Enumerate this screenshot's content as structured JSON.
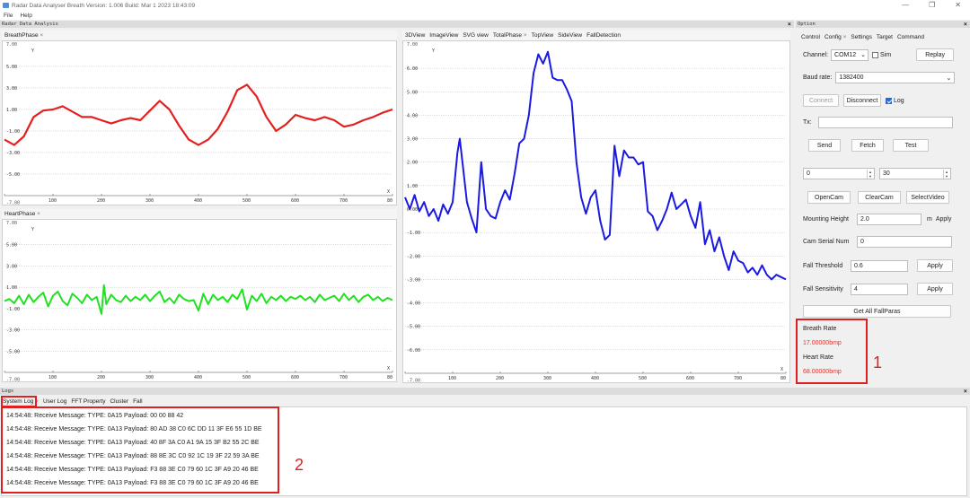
{
  "window": {
    "title": "Radar Data Analyser Breath Version: 1.006 Build: Mar  1 2023 18:43:09",
    "minimize": "—",
    "restore": "❐",
    "close": "✕"
  },
  "menu": [
    "File",
    "Help"
  ],
  "analysis": {
    "header": "Radar Data Analysis",
    "close": "×"
  },
  "breath_plot": {
    "tab": "BreathPhase",
    "chart_data": {
      "type": "line",
      "xlabel": "X",
      "ylabel": "Y",
      "xlim": [
        0,
        800
      ],
      "ylim": [
        -7,
        7
      ],
      "x_ticks": [
        0,
        100,
        200,
        300,
        400,
        500,
        600,
        700,
        800
      ],
      "x_tick_labels": [
        "0",
        "100",
        "200",
        "300",
        "400",
        "500",
        "600",
        "700",
        "80"
      ],
      "y_ticks": [
        5,
        3,
        1,
        -1,
        -3,
        -5
      ],
      "y_tick_labels": [
        "5.00",
        "3.00",
        "1.00",
        "-1.00",
        "-3.00",
        "-5.00"
      ],
      "y_top_label": "7.00",
      "y_bottom_label": "-7.00",
      "series": [
        {
          "color": "#e32020",
          "x": [
            0,
            20,
            40,
            60,
            80,
            100,
            120,
            140,
            160,
            180,
            200,
            220,
            240,
            260,
            280,
            300,
            320,
            340,
            360,
            380,
            400,
            420,
            440,
            460,
            480,
            500,
            520,
            540,
            560,
            580,
            600,
            620,
            640,
            660,
            680,
            700,
            720,
            740,
            760,
            780,
            800
          ],
          "y": [
            -1.8,
            -2.3,
            -1.5,
            0.3,
            0.9,
            1.0,
            1.3,
            0.8,
            0.3,
            0.3,
            0.0,
            -0.3,
            0.0,
            0.2,
            0.0,
            0.9,
            1.8,
            1.0,
            -0.5,
            -1.8,
            -2.3,
            -1.8,
            -0.8,
            0.8,
            2.8,
            3.3,
            2.2,
            0.3,
            -1.0,
            -0.4,
            0.5,
            0.2,
            0.0,
            0.3,
            0.0,
            -0.6,
            -0.4,
            0.0,
            0.3,
            0.7,
            1.0
          ]
        }
      ]
    }
  },
  "heart_plot": {
    "tab": "HeartPhase",
    "chart_data": {
      "type": "line",
      "xlabel": "X",
      "ylabel": "Y",
      "xlim": [
        0,
        800
      ],
      "ylim": [
        -7,
        7
      ],
      "x_ticks": [
        0,
        100,
        200,
        300,
        400,
        500,
        600,
        700,
        800
      ],
      "x_tick_labels": [
        "0",
        "100",
        "200",
        "300",
        "400",
        "500",
        "600",
        "700",
        "80"
      ],
      "y_ticks": [
        5,
        3,
        1,
        -1,
        -3,
        -5
      ],
      "y_tick_labels": [
        "5.00",
        "3.00",
        "1.00",
        "-1.00",
        "-3.00",
        "-5.00"
      ],
      "y_top_label": "7.00",
      "y_bottom_label": "-7.00",
      "series": [
        {
          "color": "#22e022",
          "x": [
            0,
            10,
            20,
            30,
            40,
            50,
            60,
            70,
            80,
            90,
            100,
            110,
            120,
            130,
            140,
            150,
            160,
            170,
            180,
            190,
            200,
            205,
            210,
            220,
            230,
            240,
            250,
            260,
            270,
            280,
            290,
            300,
            310,
            320,
            330,
            340,
            350,
            360,
            370,
            380,
            390,
            400,
            410,
            420,
            430,
            440,
            450,
            460,
            470,
            480,
            490,
            500,
            510,
            520,
            530,
            540,
            550,
            560,
            570,
            580,
            590,
            600,
            610,
            620,
            630,
            640,
            650,
            660,
            670,
            680,
            690,
            700,
            710,
            720,
            730,
            740,
            750,
            760,
            770,
            780,
            790,
            800
          ],
          "y": [
            -0.3,
            -0.1,
            -0.5,
            0.2,
            -0.6,
            0.3,
            -0.4,
            0.1,
            0.5,
            -0.8,
            0.2,
            0.6,
            -0.3,
            -0.7,
            0.4,
            0.0,
            -0.5,
            0.3,
            -0.2,
            0.1,
            -1.5,
            1.2,
            -0.6,
            0.3,
            -0.2,
            -0.4,
            0.2,
            -0.3,
            0.1,
            -0.2,
            0.3,
            -0.3,
            0.2,
            0.6,
            -0.4,
            0.0,
            -0.5,
            0.3,
            -0.1,
            -0.3,
            -0.2,
            -1.2,
            0.4,
            -0.6,
            0.3,
            -0.2,
            0.1,
            -0.4,
            0.3,
            -0.1,
            0.8,
            -1.1,
            0.2,
            -0.3,
            0.4,
            -0.5,
            0.1,
            -0.2,
            0.2,
            -0.3,
            0.1,
            -0.1,
            0.2,
            -0.2,
            0.1,
            -0.4,
            0.3,
            -0.2,
            0.0,
            0.2,
            -0.3,
            0.4,
            -0.2,
            0.2,
            -0.4,
            0.1,
            0.3,
            -0.2,
            0.1,
            -0.3,
            0.0,
            -0.2
          ]
        }
      ]
    }
  },
  "view_tabs": [
    "3DView",
    "ImageView",
    "SVG view",
    "TotalPhase",
    "TopView",
    "SideView",
    "FallDetection"
  ],
  "total_plot": {
    "chart_data": {
      "type": "line",
      "ylabel": "Y",
      "xlabel": "X",
      "xlim": [
        0,
        800
      ],
      "ylim": [
        -7,
        7
      ],
      "x_ticks": [
        0,
        100,
        200,
        300,
        400,
        500,
        600,
        700,
        800
      ],
      "x_tick_labels": [
        "0",
        "100",
        "200",
        "300",
        "400",
        "500",
        "600",
        "700",
        "80"
      ],
      "y_ticks": [
        6,
        5,
        4,
        3,
        2,
        1,
        0,
        -1,
        -2,
        -3,
        -4,
        -5,
        -6
      ],
      "y_tick_labels": [
        "6.00",
        "5.00",
        "4.00",
        "3.00",
        "2.00",
        "1.00",
        "0.00",
        "-1.00",
        "-2.00",
        "-3.00",
        "-4.00",
        "-5.00",
        "-6.00"
      ],
      "y_top_label": "7.00",
      "y_bottom_label": "-7.00",
      "series": [
        {
          "color": "#1a1ae0",
          "x": [
            0,
            10,
            20,
            30,
            40,
            50,
            60,
            70,
            80,
            90,
            100,
            110,
            115,
            120,
            130,
            140,
            150,
            160,
            170,
            180,
            190,
            200,
            210,
            220,
            230,
            240,
            250,
            260,
            270,
            280,
            290,
            300,
            310,
            320,
            330,
            340,
            350,
            360,
            370,
            380,
            390,
            400,
            410,
            420,
            430,
            440,
            450,
            460,
            470,
            480,
            490,
            500,
            510,
            520,
            530,
            540,
            550,
            560,
            570,
            580,
            590,
            600,
            610,
            620,
            630,
            640,
            650,
            660,
            670,
            680,
            690,
            700,
            710,
            720,
            730,
            740,
            750,
            760,
            770,
            780,
            790,
            800
          ],
          "y": [
            0.5,
            0.0,
            0.6,
            -0.1,
            0.3,
            -0.3,
            0.0,
            -0.5,
            0.2,
            -0.2,
            0.3,
            2.4,
            3.0,
            2.1,
            0.3,
            -0.4,
            -1.0,
            2.0,
            0.0,
            -0.3,
            -0.4,
            0.3,
            0.8,
            0.4,
            1.5,
            2.8,
            3.0,
            4.0,
            5.8,
            6.6,
            6.2,
            6.7,
            5.6,
            5.5,
            5.5,
            5.1,
            4.6,
            2.0,
            0.5,
            -0.2,
            0.5,
            0.8,
            -0.5,
            -1.3,
            -1.1,
            2.7,
            1.4,
            2.5,
            2.2,
            2.2,
            1.9,
            2.0,
            -0.1,
            -0.3,
            -0.9,
            -0.5,
            0.0,
            0.7,
            0.0,
            0.2,
            0.4,
            -0.3,
            -0.8,
            0.3,
            -1.5,
            -0.9,
            -1.8,
            -1.2,
            -2.0,
            -2.6,
            -1.8,
            -2.2,
            -2.3,
            -2.7,
            -2.5,
            -2.8,
            -2.4,
            -2.8,
            -3.0,
            -2.8,
            -2.9,
            -3.0
          ]
        }
      ]
    }
  },
  "option": {
    "header": "Option",
    "tabs": [
      "Control",
      "Config",
      "Settings",
      "Target",
      "Command"
    ],
    "channel_label": "Channel:",
    "channel_value": "COM12",
    "sim_label": "Sim",
    "replay": "Replay",
    "baud_label": "Baud rate:",
    "baud_value": "1382400",
    "connect": "Connect",
    "disconnect": "Disconnect",
    "log_label": "Log",
    "tx_label": "Tx:",
    "send": "Send",
    "fetch": "Fetch",
    "test": "Test",
    "spin_a": "0",
    "spin_b": "30",
    "opencam": "OpenCam",
    "clearcam": "ClearCam",
    "selectvideo": "SelectVideo",
    "mount_label": "Mounting Height",
    "mount_value": "2.0",
    "mount_unit": "m",
    "apply": "Apply",
    "cam_label": "Cam Serial Num",
    "cam_value": "0",
    "fallth_label": "Fall Threshold",
    "fallth_value": "0.6",
    "fallsens_label": "Fall Sensitivity",
    "fallsens_value": "4",
    "getall": "Get All FallParas",
    "breath_rate_label": "Breath Rate",
    "breath_rate_value": "17.00000bmp",
    "heart_rate_label": "Heart Rate",
    "heart_rate_value": "68.00000bmp"
  },
  "annotations": {
    "one": "1",
    "two": "2"
  },
  "logs": {
    "header": "Logs",
    "tabs": [
      "System Log",
      "User Log",
      "FFT Property",
      "Cluster",
      "Fall"
    ],
    "lines": [
      "14:54:48: Receive Message: TYPE: 0A15 Payload: 00 00 88 42",
      "14:54:48: Receive Message: TYPE: 0A13 Payload: 80 AD 38 C0 6C DD 11 3F E6 55 1D BE",
      "14:54:48: Receive Message: TYPE: 0A13 Payload: 40 8F 3A C0 A1 9A 15 3F B2 55 2C BE",
      "14:54:48: Receive Message: TYPE: 0A13 Payload: 88 8E 3C C0 92 1C 19 3F 22 59 3A BE",
      "14:54:48: Receive Message: TYPE: 0A13 Payload: F3 88 3E C0 79 60 1C 3F A9 20 46 BE",
      "14:54:48: Receive Message: TYPE: 0A13 Payload: F3 88 3E C0 79 60 1C 3F A9 20 46 BE"
    ]
  }
}
